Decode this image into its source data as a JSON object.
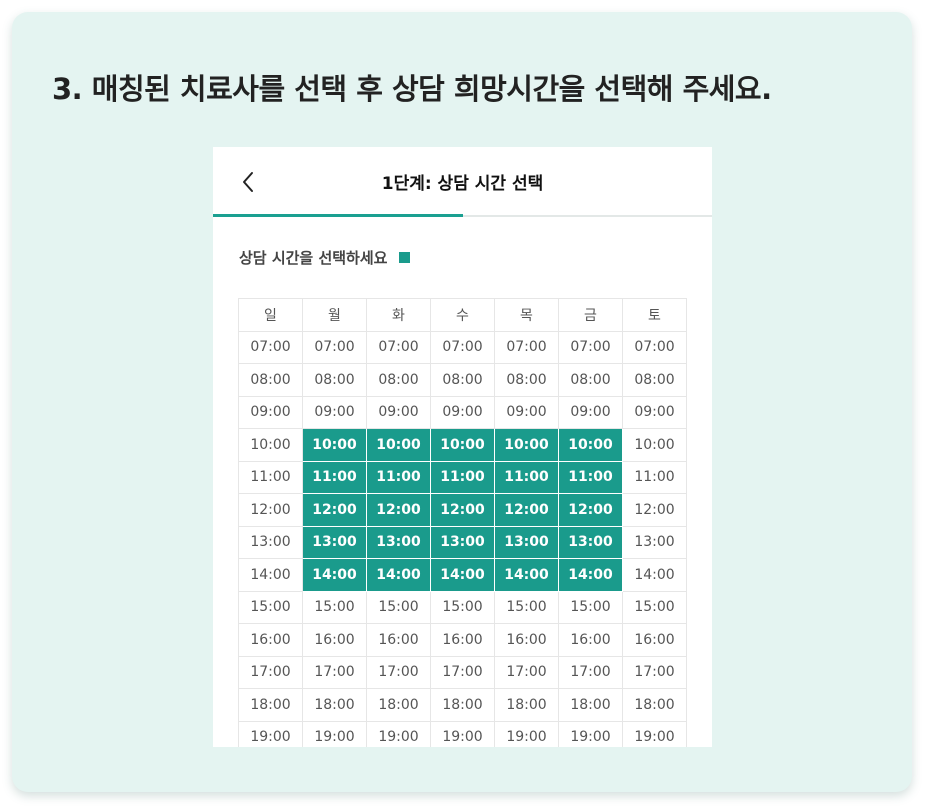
{
  "instruction": "3.  매칭된 치료사를 선택 후 상담 희망시간을 선택해 주세요.",
  "screen": {
    "title": "1단계: 상담 시간 선택",
    "back_icon": "chevron-left-icon",
    "progress_fraction": 0.5,
    "section_label": "상담 시간을 선택하세요"
  },
  "colors": {
    "accent": "#1a9b8c",
    "card_background": "#e4f4f1"
  },
  "schedule": {
    "days": [
      "일",
      "월",
      "화",
      "수",
      "목",
      "금",
      "토"
    ],
    "times": [
      "07:00",
      "08:00",
      "09:00",
      "10:00",
      "11:00",
      "12:00",
      "13:00",
      "14:00",
      "15:00",
      "16:00",
      "17:00",
      "18:00",
      "19:00"
    ],
    "selected_days": [
      "월",
      "화",
      "수",
      "목",
      "금"
    ],
    "selected_times": [
      "10:00",
      "11:00",
      "12:00",
      "13:00",
      "14:00"
    ]
  }
}
